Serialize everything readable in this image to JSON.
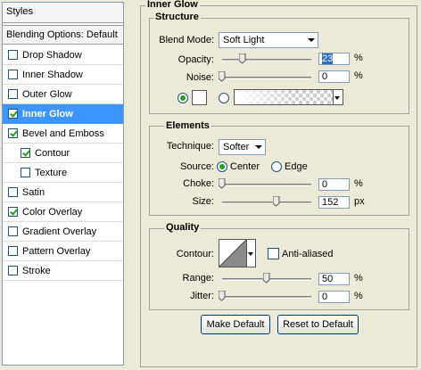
{
  "sidebar": {
    "title": "Styles",
    "blending_options": "Blending Options: Default",
    "items": [
      {
        "label": "Drop Shadow",
        "checked": false,
        "selected": false,
        "indent": false
      },
      {
        "label": "Inner Shadow",
        "checked": false,
        "selected": false,
        "indent": false
      },
      {
        "label": "Outer Glow",
        "checked": false,
        "selected": false,
        "indent": false
      },
      {
        "label": "Inner Glow",
        "checked": true,
        "selected": true,
        "indent": false
      },
      {
        "label": "Bevel and Emboss",
        "checked": true,
        "selected": false,
        "indent": false
      },
      {
        "label": "Contour",
        "checked": true,
        "selected": false,
        "indent": true
      },
      {
        "label": "Texture",
        "checked": false,
        "selected": false,
        "indent": true
      },
      {
        "label": "Satin",
        "checked": false,
        "selected": false,
        "indent": false
      },
      {
        "label": "Color Overlay",
        "checked": true,
        "selected": false,
        "indent": false
      },
      {
        "label": "Gradient Overlay",
        "checked": false,
        "selected": false,
        "indent": false
      },
      {
        "label": "Pattern Overlay",
        "checked": false,
        "selected": false,
        "indent": false
      },
      {
        "label": "Stroke",
        "checked": false,
        "selected": false,
        "indent": false
      }
    ]
  },
  "panel": {
    "title": "Inner Glow",
    "structure": {
      "title": "Structure",
      "blend_mode_label": "Blend Mode:",
      "blend_mode_value": "Soft Light",
      "opacity_label": "Opacity:",
      "opacity_value": "23",
      "opacity_unit": "%",
      "opacity_level": 23,
      "noise_label": "Noise:",
      "noise_value": "0",
      "noise_unit": "%",
      "noise_level": 0,
      "color_mode": "solid"
    },
    "elements": {
      "title": "Elements",
      "technique_label": "Technique:",
      "technique_value": "Softer",
      "source_label": "Source:",
      "source_center": "Center",
      "source_edge": "Edge",
      "source_selected": "Center",
      "choke_label": "Choke:",
      "choke_value": "0",
      "choke_unit": "%",
      "choke_level": 0,
      "size_label": "Size:",
      "size_value": "152",
      "size_unit": "px",
      "size_level": 152
    },
    "quality": {
      "title": "Quality",
      "contour_label": "Contour:",
      "anti_aliased_label": "Anti-aliased",
      "anti_aliased": false,
      "range_label": "Range:",
      "range_value": "50",
      "range_unit": "%",
      "range_level": 50,
      "jitter_label": "Jitter:",
      "jitter_value": "0",
      "jitter_unit": "%",
      "jitter_level": 0
    },
    "buttons": {
      "make_default": "Make Default",
      "reset_default": "Reset to Default"
    }
  }
}
